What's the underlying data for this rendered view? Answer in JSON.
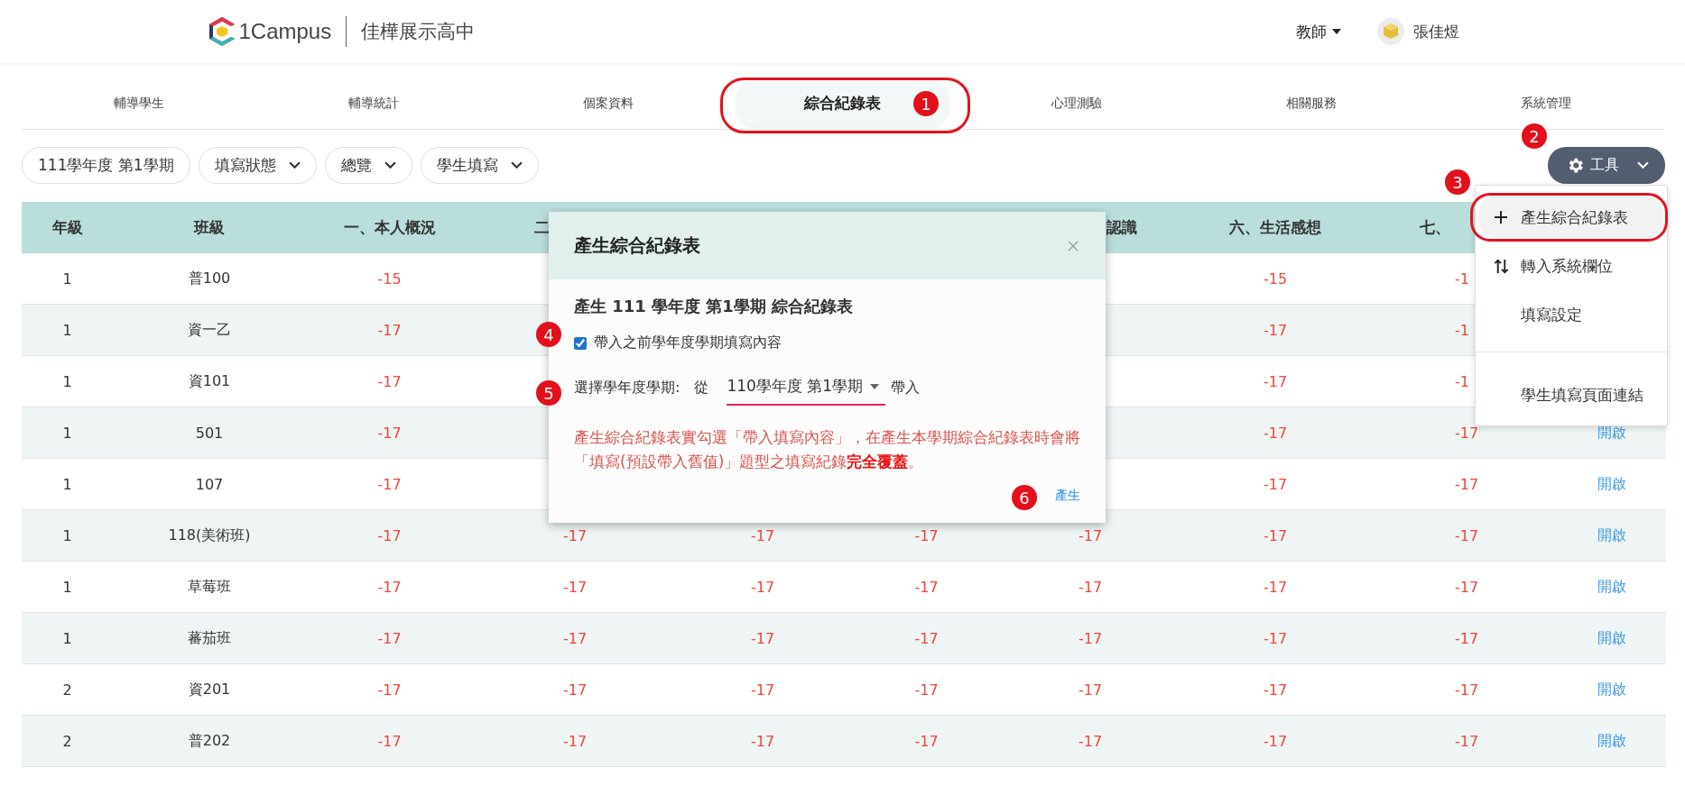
{
  "header": {
    "logo_text": "1Campus",
    "school": "佳樺展示高中",
    "role": "教師",
    "user": "張佳煜"
  },
  "nav_tabs": [
    {
      "label": "輔導學生",
      "selected": false
    },
    {
      "label": "輔導統計",
      "selected": false
    },
    {
      "label": "個案資料",
      "selected": false
    },
    {
      "label": "綜合紀錄表",
      "selected": true
    },
    {
      "label": "心理測驗",
      "selected": false
    },
    {
      "label": "相關服務",
      "selected": false
    },
    {
      "label": "系統管理",
      "selected": false
    }
  ],
  "filters": [
    {
      "label": "111學年度 第1學期",
      "dropdown": false
    },
    {
      "label": "填寫狀態",
      "dropdown": true
    },
    {
      "label": "總覽",
      "dropdown": true
    },
    {
      "label": "學生填寫",
      "dropdown": true
    }
  ],
  "tools_button": {
    "label": "工具"
  },
  "tools_menu": {
    "items": [
      {
        "kind": "add",
        "label": "產生綜合紀錄表",
        "highlighted": true
      },
      {
        "kind": "transfer",
        "label": "轉入系統欄位",
        "highlighted": false
      },
      {
        "kind": "plain",
        "label": "填寫設定",
        "highlighted": false
      },
      {
        "kind": "divider"
      },
      {
        "kind": "plain",
        "label": "學生填寫頁面連結",
        "highlighted": false
      }
    ]
  },
  "table": {
    "columns": [
      {
        "label": "年級",
        "kind": "text"
      },
      {
        "label": "班級",
        "kind": "text"
      },
      {
        "label": "一、本人概況",
        "kind": "score"
      },
      {
        "label": "二",
        "kind": "score"
      },
      {
        "kind": "score"
      },
      {
        "kind": "score"
      },
      {
        "label": "認識",
        "kind": "score"
      },
      {
        "label": "六、生活感想",
        "kind": "score"
      },
      {
        "label": "七、",
        "kind": "score"
      },
      {
        "kind": "link"
      }
    ],
    "rows": [
      {
        "cells": [
          "1",
          "普100",
          "-15",
          null,
          null,
          null,
          null,
          "-15",
          "-1",
          null
        ]
      },
      {
        "cells": [
          "1",
          "資一乙",
          "-17",
          null,
          null,
          null,
          null,
          "-17",
          "-1",
          null
        ]
      },
      {
        "cells": [
          "1",
          "資101",
          "-17",
          null,
          null,
          null,
          null,
          "-17",
          "-1",
          null
        ]
      },
      {
        "cells": [
          "1",
          "501",
          "-17",
          null,
          null,
          null,
          null,
          "-17",
          "-17",
          "開啟"
        ]
      },
      {
        "cells": [
          "1",
          "107",
          "-17",
          null,
          null,
          null,
          null,
          "-17",
          "-17",
          "開啟"
        ]
      },
      {
        "cells": [
          "1",
          "118(美術班)",
          "-17",
          "-17",
          "-17",
          "-17",
          "-17",
          "-17",
          "-17",
          "開啟"
        ]
      },
      {
        "cells": [
          "1",
          "草莓班",
          "-17",
          "-17",
          "-17",
          "-17",
          "-17",
          "-17",
          "-17",
          "開啟"
        ]
      },
      {
        "cells": [
          "1",
          "蕃茄班",
          "-17",
          "-17",
          "-17",
          "-17",
          "-17",
          "-17",
          "-17",
          "開啟"
        ]
      },
      {
        "cells": [
          "2",
          "資201",
          "-17",
          "-17",
          "-17",
          "-17",
          "-17",
          "-17",
          "-17",
          "開啟"
        ]
      },
      {
        "cells": [
          "2",
          "普202",
          "-17",
          "-17",
          "-17",
          "-17",
          "-17",
          "-17",
          "-17",
          "開啟"
        ]
      }
    ]
  },
  "dialog": {
    "title": "產生綜合紀錄表",
    "heading": "產生 111 學年度 第1學期 綜合紀錄表",
    "checkbox": {
      "label": "帶入之前學年度學期填寫內容",
      "checked": true
    },
    "select": {
      "label": "選擇學年度學期:",
      "prefix": "從",
      "value": "110學年度 第1學期",
      "suffix": "帶入"
    },
    "warning": "產生綜合紀錄表實勾選「帶入填寫內容」，在產生本學期綜合紀錄表時會將「填寫(預設帶入舊值)」題型之填寫紀錄**完全覆蓋**。",
    "confirm": "產生"
  },
  "annotations": [
    {
      "label": "1"
    },
    {
      "label": "2"
    },
    {
      "label": "3"
    },
    {
      "label": "4"
    },
    {
      "label": "5"
    },
    {
      "label": "6"
    }
  ]
}
